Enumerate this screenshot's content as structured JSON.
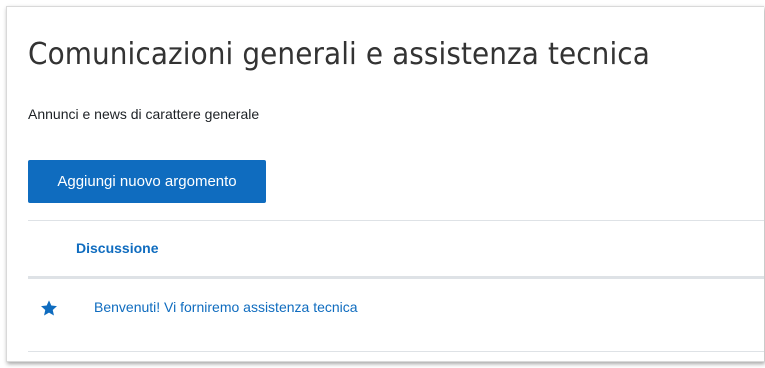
{
  "forum": {
    "title": "Comunicazioni generali e assistenza tecnica",
    "description": "Annunci e news di carattere generale"
  },
  "actions": {
    "add_topic_label": "Aggiungi nuovo argomento"
  },
  "table": {
    "columns": [
      "Discussione"
    ],
    "rows": [
      {
        "starred": true,
        "icon": "star-icon",
        "title": "Benvenuti! Vi forniremo assistenza tecnica"
      }
    ]
  },
  "colors": {
    "accent": "#0f6cbf",
    "text": "#1d2125",
    "title": "#333333",
    "border": "#dee2e6"
  }
}
